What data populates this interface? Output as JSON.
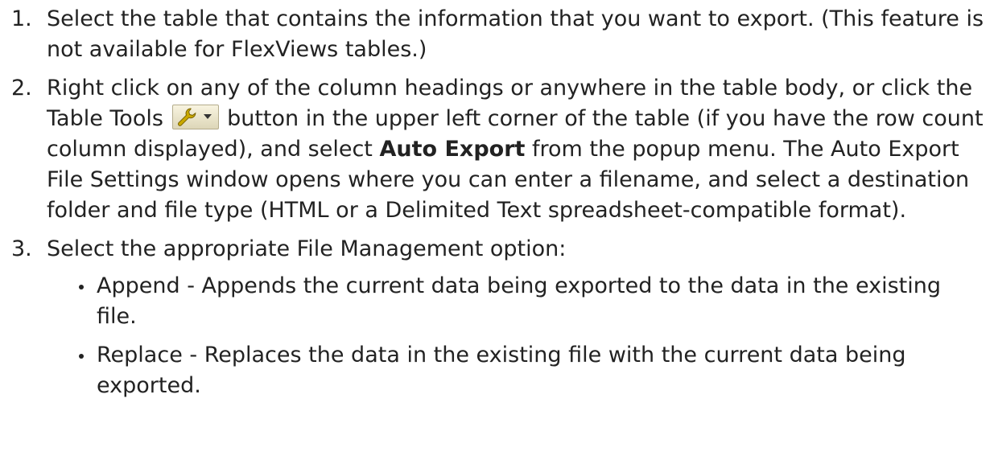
{
  "steps": [
    {
      "number": "1.",
      "text": "Select the table that contains the information that you want to export. (This feature is not available for FlexViews tables.)"
    },
    {
      "number": "2.",
      "text_before_button": "Right click on any of the column headings or anywhere in the table body, or click the Table Tools ",
      "button_icon": "wrench-icon",
      "text_after_button": " button in the upper left corner of the table (if you have the row count column displayed), and select ",
      "bold_text": "Auto Export",
      "text_end": " from the popup menu. The Auto Export File Settings window opens where you can enter a filename, and select a destination folder and file type (HTML or a Delimited Text spreadsheet-compatible format)."
    },
    {
      "number": "3.",
      "text": "Select the appropriate File Management option:",
      "sub_items": [
        "Append - Appends the current data being exported to the data in the existing file.",
        "Replace - Replaces the data in the existing file with the current data being exported."
      ]
    }
  ],
  "colors": {
    "text": "#222222",
    "button_bg": "#ede7cc",
    "wrench": "#c9a800"
  }
}
